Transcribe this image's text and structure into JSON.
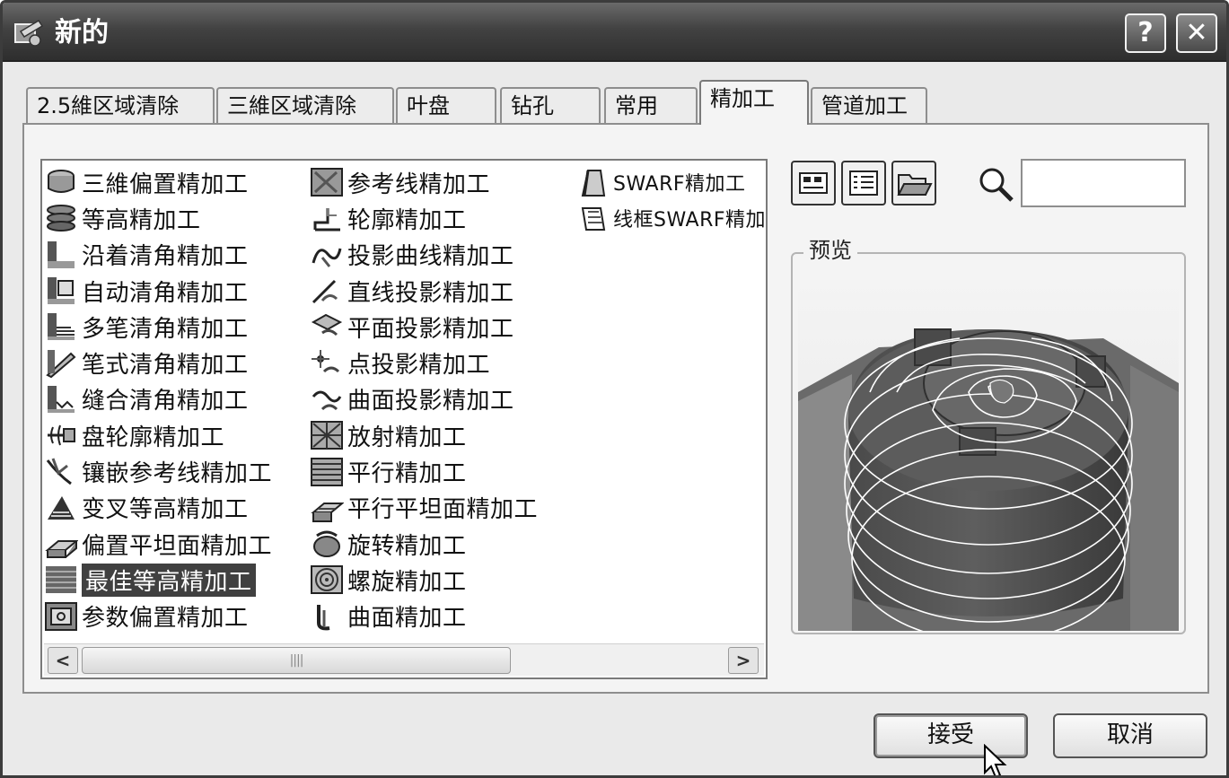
{
  "window": {
    "title": "新的"
  },
  "titlebar": {
    "help_label": "?",
    "close_label": "✕"
  },
  "tabs": [
    {
      "label": "2.5維区域清除"
    },
    {
      "label": "三維区域清除"
    },
    {
      "label": "叶盘"
    },
    {
      "label": "钻孔"
    },
    {
      "label": "常用"
    },
    {
      "label": "精加工",
      "active": true
    },
    {
      "label": "管道加工"
    }
  ],
  "strategies": {
    "column_1": [
      {
        "label": "三維偏置精加工",
        "icon": "offset-3d-icon"
      },
      {
        "label": "等高精加工",
        "icon": "constant-z-icon"
      },
      {
        "label": "沿着清角精加工",
        "icon": "along-corner-icon"
      },
      {
        "label": "自动清角精加工",
        "icon": "auto-corner-icon"
      },
      {
        "label": "多笔清角精加工",
        "icon": "multi-pencil-icon"
      },
      {
        "label": "笔式清角精加工",
        "icon": "pencil-corner-icon"
      },
      {
        "label": "缝合清角精加工",
        "icon": "stitch-corner-icon"
      },
      {
        "label": "盘轮廓精加工",
        "icon": "disc-profile-icon"
      },
      {
        "label": "镶嵌参考线精加工",
        "icon": "embedded-pattern-icon"
      },
      {
        "label": "变叉等高精加工",
        "icon": "crossed-constant-z-icon"
      },
      {
        "label": "偏置平坦面精加工",
        "icon": "offset-flat-icon"
      },
      {
        "label": "最佳等高精加工",
        "icon": "optimised-constant-z-icon",
        "selected": true
      },
      {
        "label": "参数偏置精加工",
        "icon": "parametric-offset-icon"
      }
    ],
    "column_2": [
      {
        "label": "参考线精加工",
        "icon": "pattern-icon"
      },
      {
        "label": "轮廓精加工",
        "icon": "profile-icon"
      },
      {
        "label": "投影曲线精加工",
        "icon": "curve-projection-icon"
      },
      {
        "label": "直线投影精加工",
        "icon": "line-projection-icon"
      },
      {
        "label": "平面投影精加工",
        "icon": "plane-projection-icon"
      },
      {
        "label": "点投影精加工",
        "icon": "point-projection-icon"
      },
      {
        "label": "曲面投影精加工",
        "icon": "surface-projection-icon"
      },
      {
        "label": "放射精加工",
        "icon": "radial-icon"
      },
      {
        "label": "平行精加工",
        "icon": "raster-icon"
      },
      {
        "label": "平行平坦面精加工",
        "icon": "raster-flat-icon"
      },
      {
        "label": "旋转精加工",
        "icon": "rotary-icon"
      },
      {
        "label": "螺旋精加工",
        "icon": "spiral-icon"
      },
      {
        "label": "曲面精加工",
        "icon": "surface-icon"
      }
    ],
    "column_3": [
      {
        "label": "SWARF精加工",
        "icon": "swarf-icon"
      },
      {
        "label": "线框SWARF精加",
        "icon": "wireframe-swarf-icon"
      }
    ]
  },
  "scrollbar": {
    "left": "<",
    "right": ">",
    "thumb_grip": "||||"
  },
  "search": {
    "value": "",
    "placeholder": ""
  },
  "preview": {
    "label": "预览"
  },
  "buttons": {
    "accept": "接受",
    "cancel": "取消"
  },
  "colors": {
    "titlebar": "#3a3a3a",
    "selection": "#404040",
    "panel": "#f4f4f4"
  }
}
